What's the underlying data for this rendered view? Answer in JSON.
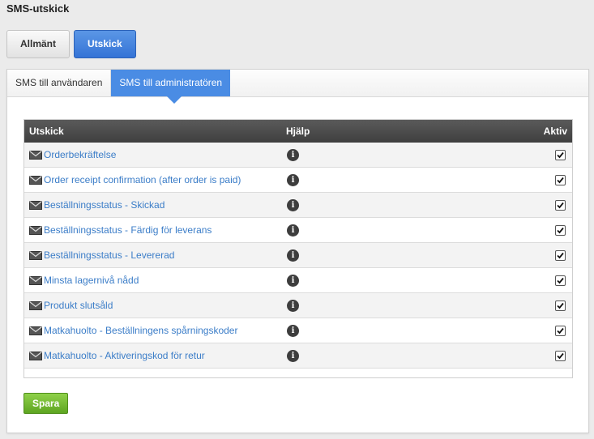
{
  "page": {
    "title": "SMS-utskick"
  },
  "top_tabs": [
    {
      "label": "Allmänt",
      "active": false
    },
    {
      "label": "Utskick",
      "active": true
    }
  ],
  "sub_tabs": [
    {
      "label": "SMS till användaren",
      "active": false
    },
    {
      "label": "SMS till administratören",
      "active": true
    }
  ],
  "table": {
    "headers": {
      "name": "Utskick",
      "help": "Hjälp",
      "active": "Aktiv"
    },
    "rows": [
      {
        "label": "Orderbekräftelse",
        "active": true
      },
      {
        "label": "Order receipt confirmation (after order is paid)",
        "active": true
      },
      {
        "label": "Beställningsstatus - Skickad",
        "active": true
      },
      {
        "label": "Beställningsstatus - Färdig för leverans",
        "active": true
      },
      {
        "label": "Beställningsstatus - Levererad",
        "active": true
      },
      {
        "label": "Minsta lagernivå nådd",
        "active": true
      },
      {
        "label": "Produkt slutsåld",
        "active": true
      },
      {
        "label": "Matkahuolto - Beställningens spårningskoder",
        "active": true
      },
      {
        "label": "Matkahuolto - Aktiveringskod för retur",
        "active": true
      }
    ]
  },
  "actions": {
    "save_label": "Spara"
  },
  "icons": {
    "row_icon": "envelope-icon",
    "help_icon": "info-icon",
    "check_icon": "checkmark-icon"
  },
  "colors": {
    "accent": "#4a8ce4",
    "link": "#3b7dc8",
    "save": "#6fb52c",
    "header": "#4a4a4a"
  }
}
